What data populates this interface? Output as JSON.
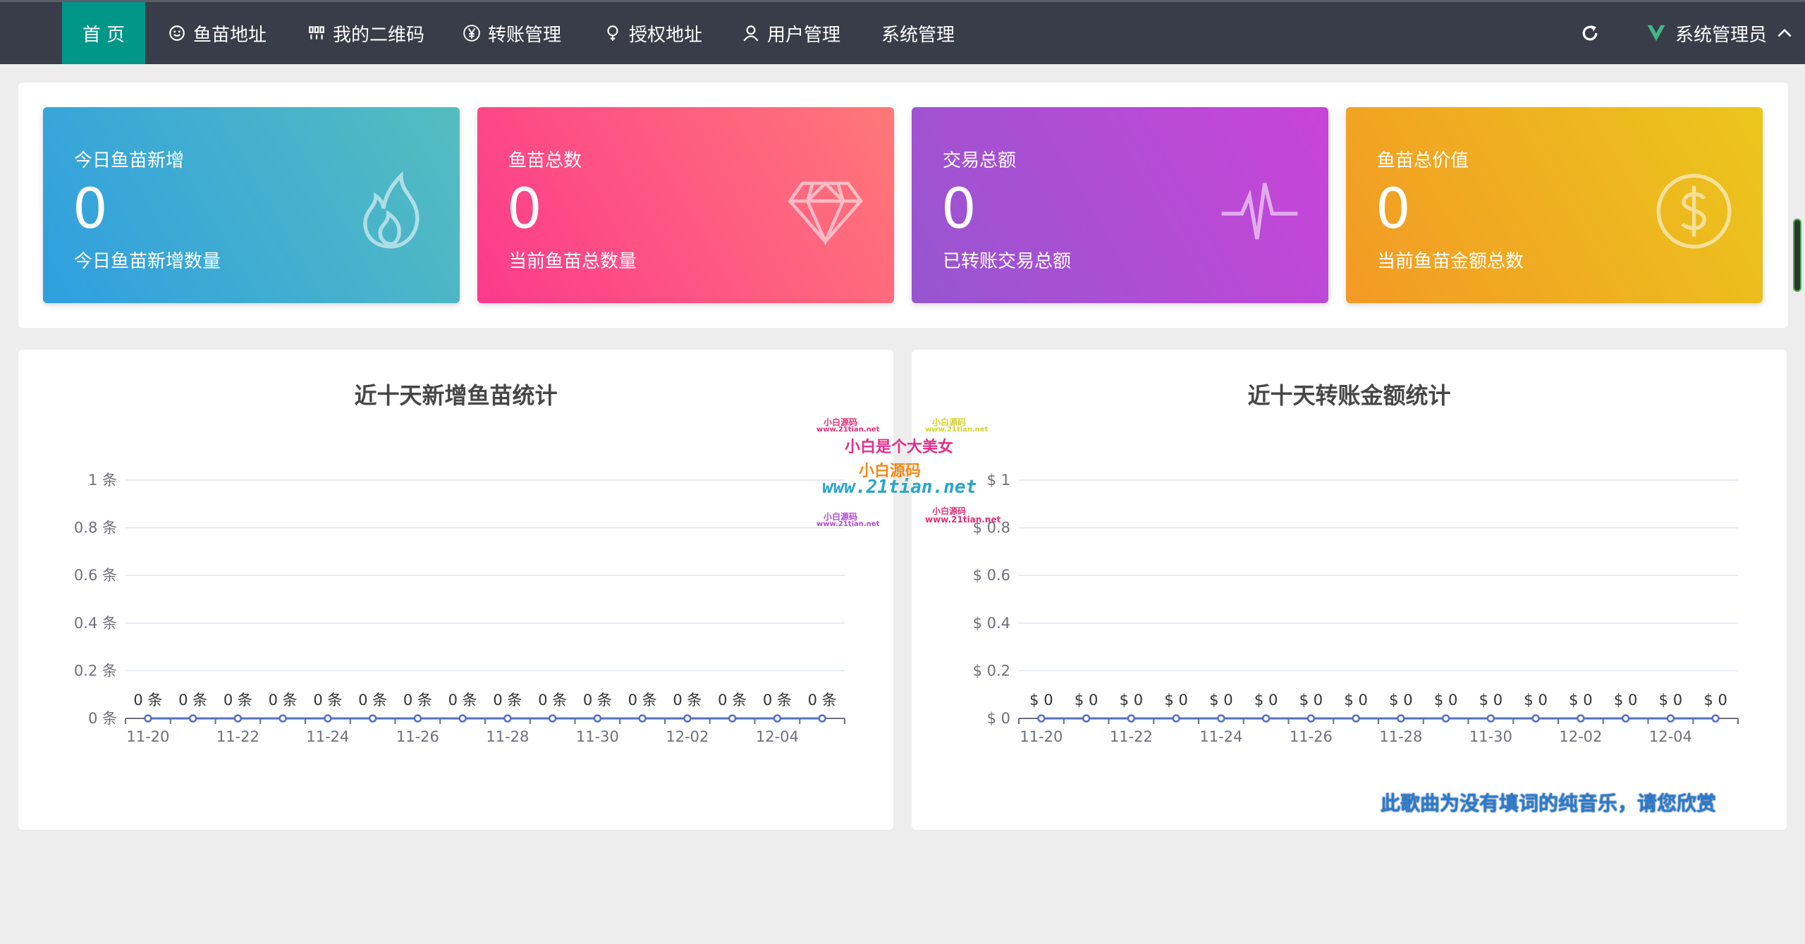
{
  "nav": {
    "items": [
      {
        "label": "首 页",
        "icon": "home",
        "active": true
      },
      {
        "label": "鱼苗地址",
        "icon": "smile-icon"
      },
      {
        "label": "我的二维码",
        "icon": "qrcode-icon"
      },
      {
        "label": "转账管理",
        "icon": "yen-icon"
      },
      {
        "label": "授权地址",
        "icon": "location-pin-icon"
      },
      {
        "label": "用户管理",
        "icon": "user-icon"
      },
      {
        "label": "系统管理",
        "icon": ""
      }
    ],
    "user": "系统管理员",
    "accent": "#009688"
  },
  "stats": [
    {
      "title": "今日鱼苗新增",
      "value": "0",
      "desc": "今日鱼苗新增数量",
      "icon": "fire-icon",
      "colors": [
        "#2f9fe0",
        "#55bdbf"
      ]
    },
    {
      "title": "鱼苗总数",
      "value": "0",
      "desc": "当前鱼苗总数量",
      "icon": "diamond-icon",
      "colors": [
        "#fc3a8c",
        "#ff7878"
      ]
    },
    {
      "title": "交易总额",
      "value": "0",
      "desc": "已转账交易总额",
      "icon": "pulse-icon",
      "colors": [
        "#9656d0",
        "#c944d9"
      ]
    },
    {
      "title": "鱼苗总价值",
      "value": "0",
      "desc": "当前鱼苗金额总数",
      "icon": "dollar-icon",
      "colors": [
        "#f39a25",
        "#ebc61c"
      ]
    }
  ],
  "charts": {
    "left_title": "近十天新增鱼苗统计",
    "right_title": "近十天转账金额统计",
    "left_y_ticks": [
      "0 条",
      "0.2 条",
      "0.4 条",
      "0.6 条",
      "0.8 条",
      "1 条"
    ],
    "right_y_ticks": [
      "$ 0",
      "$ 0.2",
      "$ 0.4",
      "$ 0.6",
      "$ 0.8",
      "$ 1"
    ],
    "x_ticks": [
      "11-20",
      "11-22",
      "11-24",
      "11-26",
      "11-28",
      "11-30",
      "12-02",
      "12-04"
    ],
    "left_point_label": "0 条",
    "right_point_label": "$ 0"
  },
  "chart_data": [
    {
      "type": "line",
      "title": "近十天新增鱼苗统计",
      "x": [
        "11-20",
        "11-21",
        "11-22",
        "11-23",
        "11-24",
        "11-25",
        "11-26",
        "11-27",
        "11-28",
        "11-29",
        "11-30",
        "12-01",
        "12-02",
        "12-03",
        "12-04",
        "12-05"
      ],
      "values": [
        0,
        0,
        0,
        0,
        0,
        0,
        0,
        0,
        0,
        0,
        0,
        0,
        0,
        0,
        0,
        0
      ],
      "ylim": [
        0,
        1
      ],
      "y_unit": "条",
      "grid": true,
      "line_color": "#5470c6"
    },
    {
      "type": "line",
      "title": "近十天转账金额统计",
      "x": [
        "11-20",
        "11-21",
        "11-22",
        "11-23",
        "11-24",
        "11-25",
        "11-26",
        "11-27",
        "11-28",
        "11-29",
        "11-30",
        "12-01",
        "12-02",
        "12-03",
        "12-04",
        "12-05"
      ],
      "values": [
        0,
        0,
        0,
        0,
        0,
        0,
        0,
        0,
        0,
        0,
        0,
        0,
        0,
        0,
        0,
        0
      ],
      "ylim": [
        0,
        1
      ],
      "y_unit": "$",
      "grid": true,
      "line_color": "#5470c6"
    }
  ],
  "watermark": {
    "line1": "小白是个大美女",
    "line2": "小白源码",
    "line3": "www.21tian.net",
    "small_a": "小白源码",
    "small_b": "www.21tian.net"
  },
  "lyric": "此歌曲为没有填词的纯音乐，请您欣赏"
}
